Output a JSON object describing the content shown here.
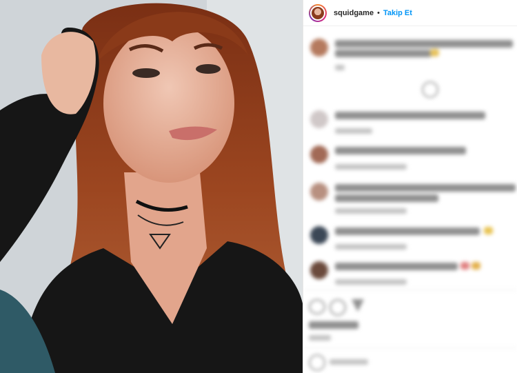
{
  "post_header": {
    "username": "squidgame",
    "separator": "•",
    "follow_label": "Takip Et"
  },
  "icons": {
    "avatar": "profile-avatar",
    "like": "heart-icon",
    "comment": "comment-icon",
    "share": "paper-plane-icon",
    "more_replies": "plus-circle-icon",
    "add_comment": "emoji-icon"
  },
  "colors": {
    "follow_link": "#0095f6",
    "text": "#262626",
    "border": "#efefef"
  }
}
